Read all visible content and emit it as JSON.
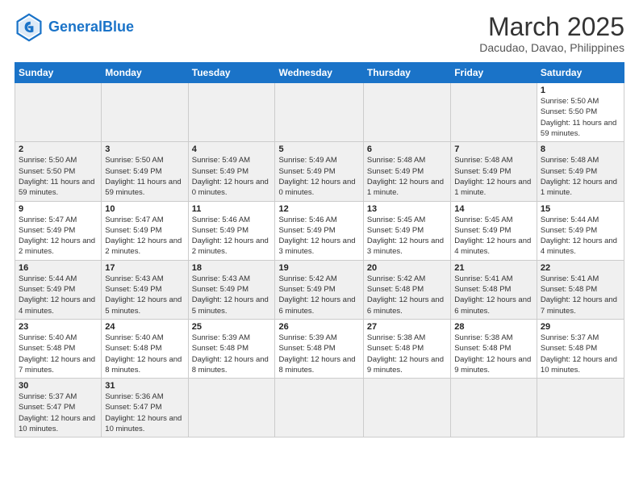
{
  "header": {
    "logo_general": "General",
    "logo_blue": "Blue",
    "month_title": "March 2025",
    "location": "Dacudao, Davao, Philippines"
  },
  "days_of_week": [
    "Sunday",
    "Monday",
    "Tuesday",
    "Wednesday",
    "Thursday",
    "Friday",
    "Saturday"
  ],
  "weeks": [
    [
      {
        "num": "",
        "info": ""
      },
      {
        "num": "",
        "info": ""
      },
      {
        "num": "",
        "info": ""
      },
      {
        "num": "",
        "info": ""
      },
      {
        "num": "",
        "info": ""
      },
      {
        "num": "",
        "info": ""
      },
      {
        "num": "1",
        "info": "Sunrise: 5:50 AM\nSunset: 5:50 PM\nDaylight: 11 hours and 59 minutes."
      }
    ],
    [
      {
        "num": "2",
        "info": "Sunrise: 5:50 AM\nSunset: 5:50 PM\nDaylight: 11 hours and 59 minutes."
      },
      {
        "num": "3",
        "info": "Sunrise: 5:50 AM\nSunset: 5:49 PM\nDaylight: 11 hours and 59 minutes."
      },
      {
        "num": "4",
        "info": "Sunrise: 5:49 AM\nSunset: 5:49 PM\nDaylight: 12 hours and 0 minutes."
      },
      {
        "num": "5",
        "info": "Sunrise: 5:49 AM\nSunset: 5:49 PM\nDaylight: 12 hours and 0 minutes."
      },
      {
        "num": "6",
        "info": "Sunrise: 5:48 AM\nSunset: 5:49 PM\nDaylight: 12 hours and 1 minute."
      },
      {
        "num": "7",
        "info": "Sunrise: 5:48 AM\nSunset: 5:49 PM\nDaylight: 12 hours and 1 minute."
      },
      {
        "num": "8",
        "info": "Sunrise: 5:48 AM\nSunset: 5:49 PM\nDaylight: 12 hours and 1 minute."
      }
    ],
    [
      {
        "num": "9",
        "info": "Sunrise: 5:47 AM\nSunset: 5:49 PM\nDaylight: 12 hours and 2 minutes."
      },
      {
        "num": "10",
        "info": "Sunrise: 5:47 AM\nSunset: 5:49 PM\nDaylight: 12 hours and 2 minutes."
      },
      {
        "num": "11",
        "info": "Sunrise: 5:46 AM\nSunset: 5:49 PM\nDaylight: 12 hours and 2 minutes."
      },
      {
        "num": "12",
        "info": "Sunrise: 5:46 AM\nSunset: 5:49 PM\nDaylight: 12 hours and 3 minutes."
      },
      {
        "num": "13",
        "info": "Sunrise: 5:45 AM\nSunset: 5:49 PM\nDaylight: 12 hours and 3 minutes."
      },
      {
        "num": "14",
        "info": "Sunrise: 5:45 AM\nSunset: 5:49 PM\nDaylight: 12 hours and 4 minutes."
      },
      {
        "num": "15",
        "info": "Sunrise: 5:44 AM\nSunset: 5:49 PM\nDaylight: 12 hours and 4 minutes."
      }
    ],
    [
      {
        "num": "16",
        "info": "Sunrise: 5:44 AM\nSunset: 5:49 PM\nDaylight: 12 hours and 4 minutes."
      },
      {
        "num": "17",
        "info": "Sunrise: 5:43 AM\nSunset: 5:49 PM\nDaylight: 12 hours and 5 minutes."
      },
      {
        "num": "18",
        "info": "Sunrise: 5:43 AM\nSunset: 5:49 PM\nDaylight: 12 hours and 5 minutes."
      },
      {
        "num": "19",
        "info": "Sunrise: 5:42 AM\nSunset: 5:49 PM\nDaylight: 12 hours and 6 minutes."
      },
      {
        "num": "20",
        "info": "Sunrise: 5:42 AM\nSunset: 5:48 PM\nDaylight: 12 hours and 6 minutes."
      },
      {
        "num": "21",
        "info": "Sunrise: 5:41 AM\nSunset: 5:48 PM\nDaylight: 12 hours and 6 minutes."
      },
      {
        "num": "22",
        "info": "Sunrise: 5:41 AM\nSunset: 5:48 PM\nDaylight: 12 hours and 7 minutes."
      }
    ],
    [
      {
        "num": "23",
        "info": "Sunrise: 5:40 AM\nSunset: 5:48 PM\nDaylight: 12 hours and 7 minutes."
      },
      {
        "num": "24",
        "info": "Sunrise: 5:40 AM\nSunset: 5:48 PM\nDaylight: 12 hours and 8 minutes."
      },
      {
        "num": "25",
        "info": "Sunrise: 5:39 AM\nSunset: 5:48 PM\nDaylight: 12 hours and 8 minutes."
      },
      {
        "num": "26",
        "info": "Sunrise: 5:39 AM\nSunset: 5:48 PM\nDaylight: 12 hours and 8 minutes."
      },
      {
        "num": "27",
        "info": "Sunrise: 5:38 AM\nSunset: 5:48 PM\nDaylight: 12 hours and 9 minutes."
      },
      {
        "num": "28",
        "info": "Sunrise: 5:38 AM\nSunset: 5:48 PM\nDaylight: 12 hours and 9 minutes."
      },
      {
        "num": "29",
        "info": "Sunrise: 5:37 AM\nSunset: 5:48 PM\nDaylight: 12 hours and 10 minutes."
      }
    ],
    [
      {
        "num": "30",
        "info": "Sunrise: 5:37 AM\nSunset: 5:47 PM\nDaylight: 12 hours and 10 minutes."
      },
      {
        "num": "31",
        "info": "Sunrise: 5:36 AM\nSunset: 5:47 PM\nDaylight: 12 hours and 10 minutes."
      },
      {
        "num": "",
        "info": ""
      },
      {
        "num": "",
        "info": ""
      },
      {
        "num": "",
        "info": ""
      },
      {
        "num": "",
        "info": ""
      },
      {
        "num": "",
        "info": ""
      }
    ]
  ]
}
